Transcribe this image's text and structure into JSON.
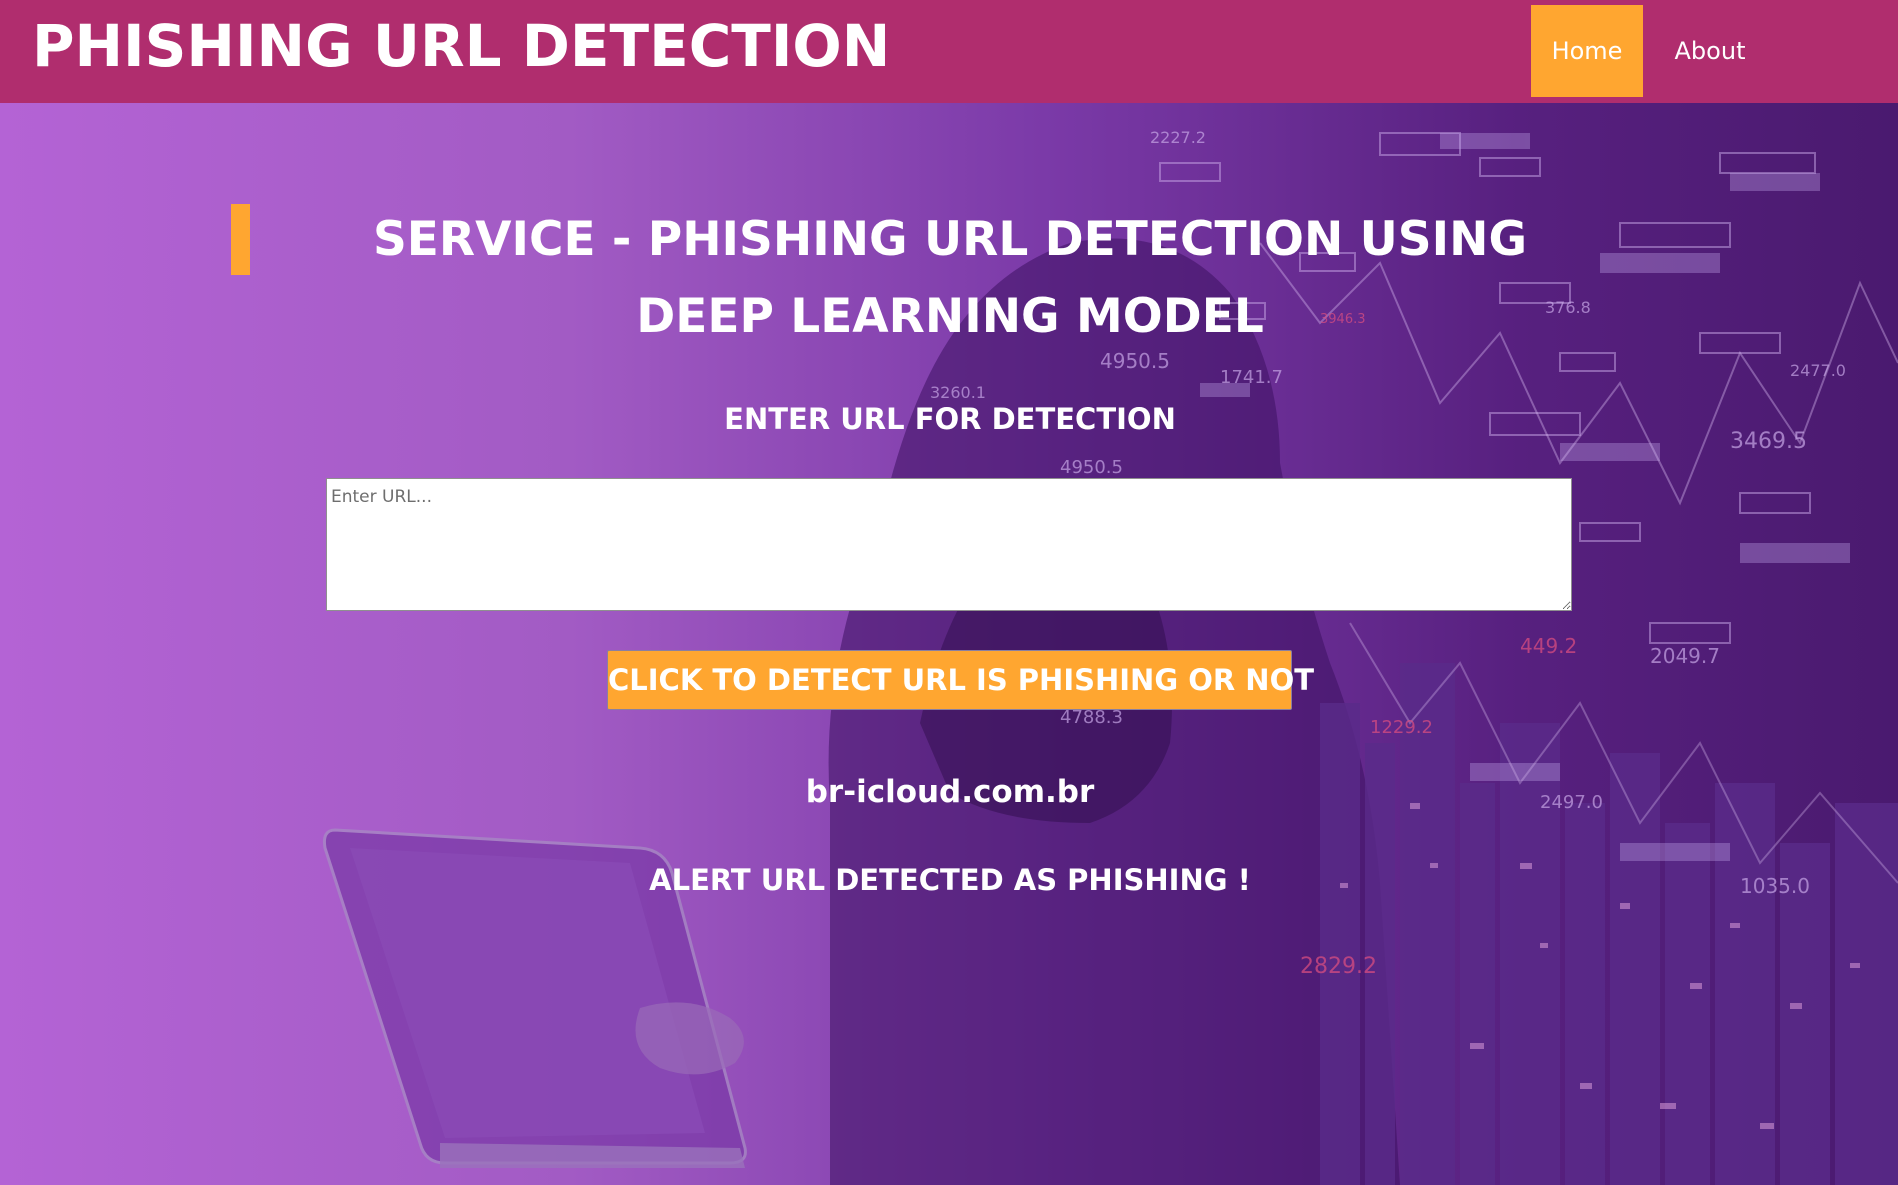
{
  "header": {
    "brand": "PHISHING URL DETECTION",
    "nav": [
      {
        "label": "Home",
        "active": true
      },
      {
        "label": "About",
        "active": false
      }
    ]
  },
  "main": {
    "service_title": "SERVICE - PHISHING URL DETECTION USING DEEP LEARNING MODEL",
    "input_label": "ENTER URL FOR DETECTION",
    "input_placeholder": "Enter URL...",
    "input_value": "",
    "detect_button": "CLICK TO DETECT URL IS PHISHING OR NOT",
    "result_url": "br-icloud.com.br",
    "result_message": "ALERT URL DETECTED AS PHISHING !"
  },
  "background": {
    "numbers": [
      "2227.2",
      "376.8",
      "4950.5",
      "1741.7",
      "2477.0",
      "3469.5",
      "4950.5",
      "2049.7",
      "449.2",
      "4788.3",
      "1229.2",
      "2497.0",
      "1035.0",
      "2829.2",
      "3946.3",
      "3260.1"
    ]
  },
  "colors": {
    "header_bg": "#b02d6e",
    "accent": "#ffa630",
    "text": "#ffffff"
  }
}
